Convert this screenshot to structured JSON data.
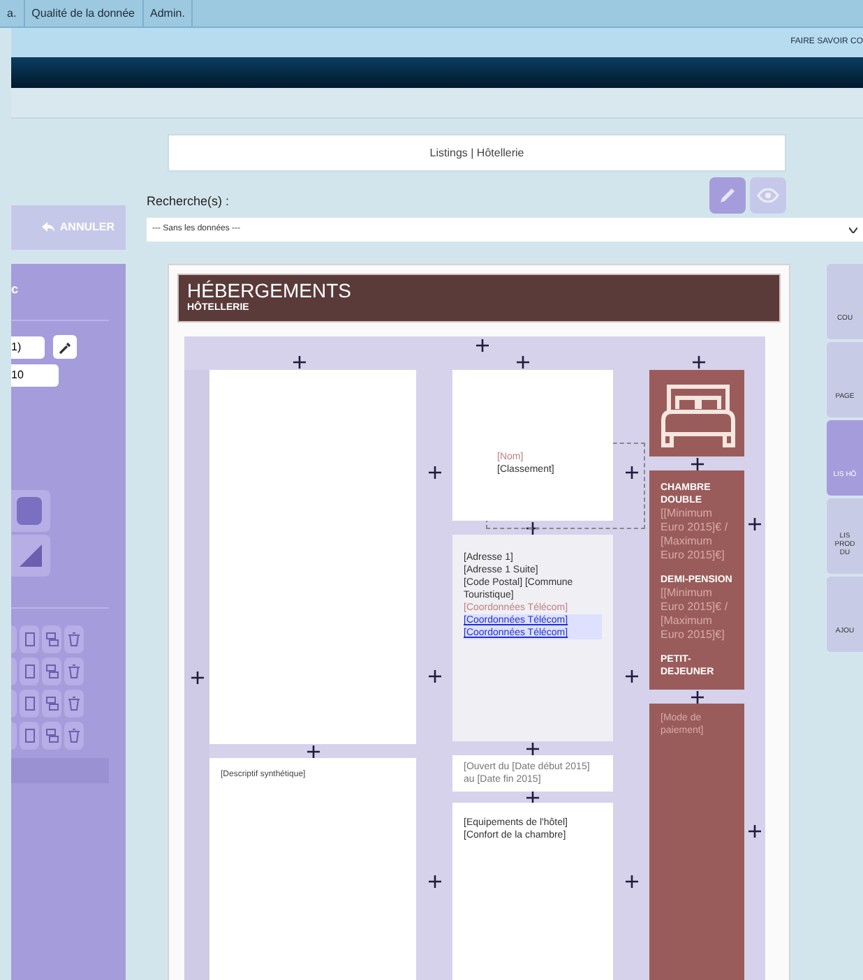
{
  "top_tabs": [
    {
      "label": "a."
    },
    {
      "label": "Qualité de la donnée"
    },
    {
      "label": "Admin."
    }
  ],
  "header_link": "FAIRE SAVOIR CO",
  "page_title": "Listings | Hôtellerie",
  "cancel_button": "ANNULER",
  "left_panel": {
    "title": "c",
    "fields": [
      "1)",
      "10"
    ]
  },
  "search_label": "Recherche(s) :",
  "search_select": {
    "value": "--- Sans les données ---"
  },
  "document": {
    "title": "HÉBERGEMENTS",
    "subtitle": "HÔTELLERIE",
    "name_block": [
      {
        "kind": "accent",
        "text": "[Nom]"
      },
      {
        "kind": "plain",
        "text": "[Classement]"
      }
    ],
    "address_block": [
      {
        "kind": "plain",
        "text": "[Adresse 1]"
      },
      {
        "kind": "plain",
        "text": "[Adresse 1 Suite]"
      },
      {
        "kind": "plain",
        "text": "[Code Postal] [Commune Touristique]"
      },
      {
        "kind": "accent",
        "text": "[Coordonnées Télécom]"
      },
      {
        "kind": "link",
        "text": "[Coordonnées Télécom]"
      },
      {
        "kind": "link",
        "text": "[Coordonnées Télécom]"
      }
    ],
    "description": "[Descriptif synthétique]",
    "opening": "[Ouvert du [Date début 2015] au [Date fin 2015]",
    "equipment": [
      "[Equipements de l'hôtel]",
      "[Confort de la chambre]"
    ],
    "prices": [
      {
        "heading": "CHAMBRE DOUBLE",
        "value": "[[Minimum Euro 2015]€ / [Maximum Euro 2015]€]"
      },
      {
        "heading": "DEMI-PENSION",
        "value": "[[Minimum Euro 2015]€ / [Maximum Euro 2015]€]"
      },
      {
        "heading": "PETIT-DEJEUNER"
      }
    ],
    "payment": "[Mode de paiement]"
  },
  "right_tabs": [
    {
      "label": "COU",
      "selected": false
    },
    {
      "label": "PAGE",
      "selected": false
    },
    {
      "label": "LIS HÔ",
      "selected": true
    },
    {
      "label": "LIS PROD DU",
      "selected": false
    },
    {
      "label": "AJOU",
      "selected": false
    }
  ]
}
